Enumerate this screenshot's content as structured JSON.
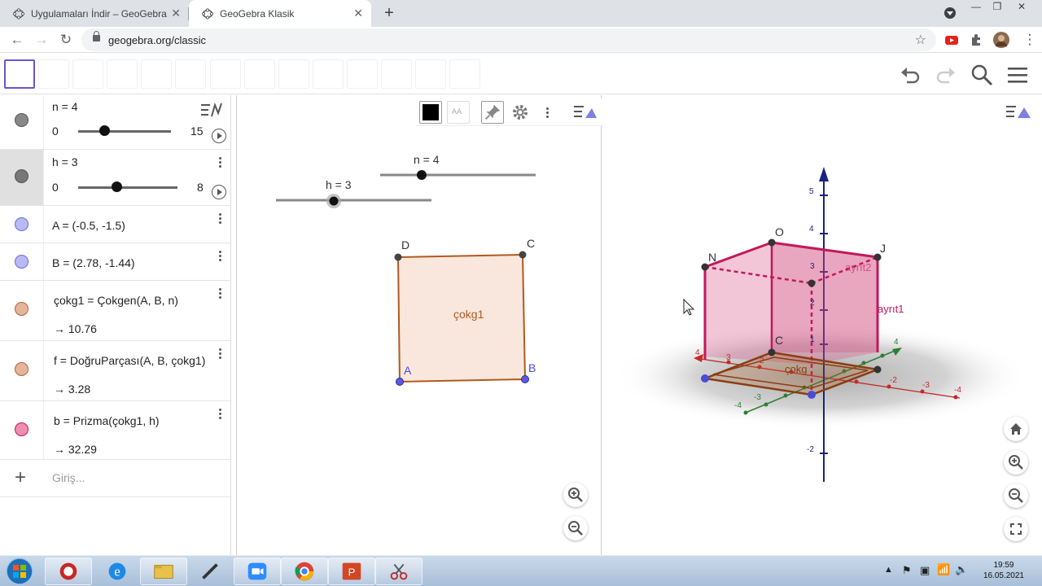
{
  "browser": {
    "tabs": [
      {
        "title": "Uygulamaları İndir – GeoGebra"
      },
      {
        "title": "GeoGebra Klasik"
      }
    ],
    "url": "geogebra.org/classic"
  },
  "algebra": {
    "slider_n": {
      "label": "n = 4",
      "min": "0",
      "max": "15",
      "value": 4
    },
    "slider_h": {
      "label": "h = 3",
      "min": "0",
      "max": "8",
      "value": 3
    },
    "A": "A = (-0.5, -1.5)",
    "B": "B = (2.78, -1.44)",
    "cokg1": {
      "def": "çokg1 = Çokgen(A, B, n)",
      "value": "→ 10.76"
    },
    "f": {
      "def": "f = DoğruParçası(A, B, çokg1)",
      "value": "→ 3.28"
    },
    "b": {
      "def": "b = Prizma(çokg1, h)",
      "value": "→ 32.29"
    },
    "input_placeholder": "Giriş..."
  },
  "graphics": {
    "slider_n_label": "n = 4",
    "slider_h_label": "h = 3",
    "points": {
      "A": "A",
      "B": "B",
      "C": "C",
      "D": "D"
    },
    "polygon_label": "çokg1"
  },
  "graphics3d": {
    "axis_ticks": [
      "5",
      "4",
      "3",
      "2",
      "1",
      "-2",
      "4",
      "-4",
      "-3",
      "-2",
      "-4",
      "-3",
      "2",
      "3",
      "4"
    ],
    "labels": {
      "N": "N",
      "O": "O",
      "J": "J",
      "C": "C",
      "ayrit1": "ayrıt1",
      "ayrit2": "ayrıt2",
      "cokg": "çokg"
    }
  },
  "taskbar": {
    "time": "19:59",
    "date": "16.05.2021"
  },
  "colors": {
    "accent": "#6557d2",
    "polygon_edge": "#b05a1e",
    "polygon_fill": "#f9e7dd",
    "prism": "#c2185b",
    "point_blue": "#4b4bd6"
  }
}
